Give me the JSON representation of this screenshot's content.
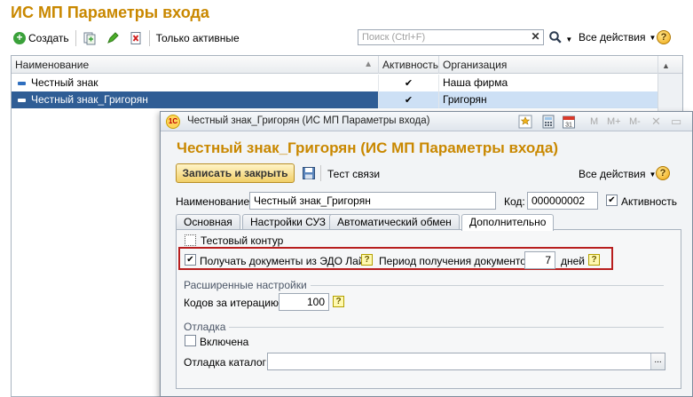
{
  "main": {
    "title": "ИС МП Параметры входа",
    "toolbar": {
      "create_label": "Создать",
      "only_active_label": "Только активные",
      "all_actions_label": "Все действия",
      "help_label": "?"
    },
    "search": {
      "placeholder": "Поиск (Ctrl+F)",
      "value": ""
    },
    "table": {
      "columns": [
        "Наименование",
        "Активность",
        "Организация"
      ],
      "rows": [
        {
          "name": "Честный знак",
          "active": "✔",
          "org": "Наша фирма",
          "selected": false
        },
        {
          "name": "Честный знак_Григорян",
          "active": "✔",
          "org": "Григорян",
          "selected": true
        }
      ]
    }
  },
  "dialog": {
    "window_title": "Честный знак_Григорян (ИС МП Параметры входа)",
    "logo_text": "1С",
    "toolbar_mini": [
      "M",
      "M+",
      "M-"
    ],
    "heading": "Честный знак_Григорян (ИС МП Параметры входа)",
    "save_close_label": "Записать и закрыть",
    "test_link_label": "Тест связи",
    "all_actions_label": "Все действия",
    "name_label": "Наименование:",
    "name_value": "Честный знак_Григорян",
    "code_label": "Код:",
    "code_value": "000000002",
    "active_label": "Активность",
    "tabs": [
      "Основная",
      "Настройки СУЗ",
      "Автоматический обмен",
      "Дополнительно"
    ],
    "active_tab": "Дополнительно",
    "extra": {
      "test_contour_label": "Тестовый контур",
      "edo_label": "Получать документы из ЭДО Лайт",
      "period_label": "Период получения документов:",
      "period_value": "7",
      "days_label": "дней",
      "advanced_group": "Расширенные настройки",
      "codes_label": "Кодов за итерацию:",
      "codes_value": "100",
      "debug_group": "Отладка",
      "debug_enabled_label": "Включена",
      "debug_dir_label": "Отладка каталог:",
      "debug_dir_value": "",
      "dots": "..."
    }
  }
}
